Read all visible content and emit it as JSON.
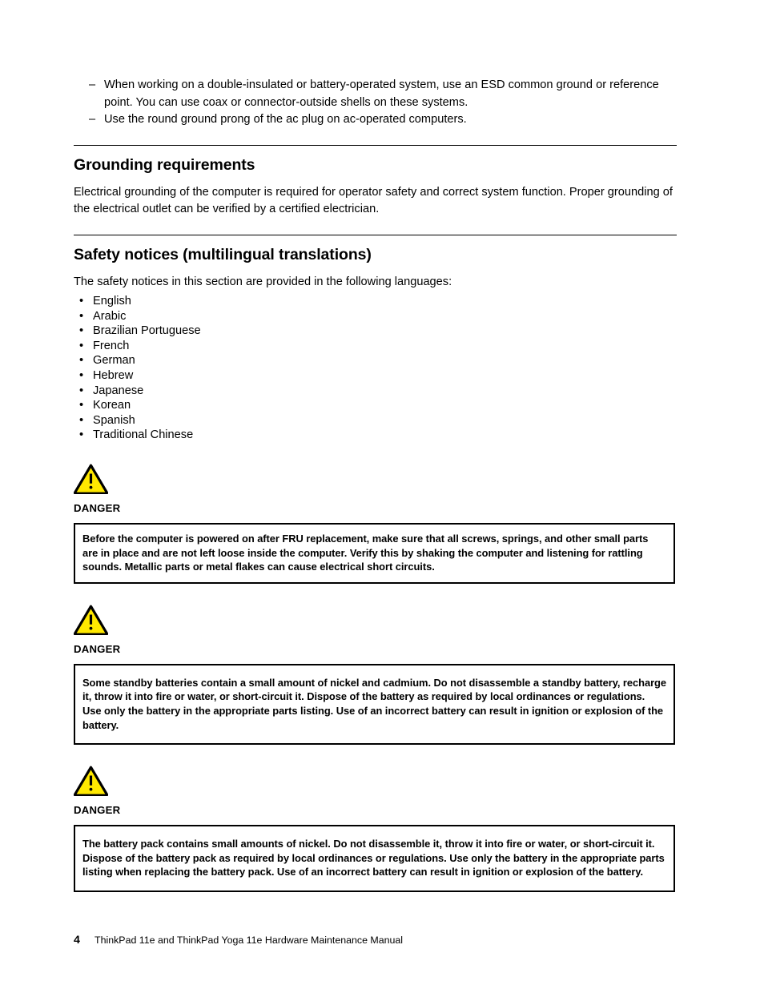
{
  "intro_list": {
    "marker": "–",
    "items": [
      "When working on a double-insulated or battery-operated system, use an ESD common ground or reference point.  You can use coax or connector-outside shells on these systems.",
      "Use the round ground prong of the ac plug on ac-operated computers."
    ]
  },
  "sections": [
    {
      "heading": "Grounding requirements",
      "body": "Electrical grounding of the computer is required for operator safety and correct system function.  Proper grounding of the electrical outlet can be verified by a certified electrician."
    },
    {
      "heading": "Safety notices (multilingual translations)",
      "body": "The safety notices in this section are provided in the following languages:"
    }
  ],
  "language_list": {
    "marker": "•",
    "items": [
      "English",
      "Arabic",
      "Brazilian Portuguese",
      "French",
      "German",
      "Hebrew",
      "Japanese",
      "Korean",
      "Spanish",
      "Traditional Chinese"
    ]
  },
  "notices": [
    {
      "icon": "warning-triangle-icon",
      "label": "DANGER",
      "text": "Before the computer is powered on after FRU replacement, make sure that all screws, springs, and other small parts are in place and are not left loose inside the computer.  Verify this by shaking the computer and listening for rattling sounds.  Metallic parts or metal flakes can cause electrical short circuits."
    },
    {
      "icon": "warning-triangle-icon",
      "label": "DANGER",
      "text": "Some standby batteries contain a small amount of nickel and cadmium. Do not disassemble a standby battery, recharge it, throw it into fire or water, or short-circuit it. Dispose of the battery as required by local ordinances or regulations.  Use only the battery in the appropriate parts listing.  Use of an incorrect battery can result in ignition or explosion of the battery."
    },
    {
      "icon": "warning-triangle-icon",
      "label": "DANGER",
      "text": "The battery pack contains small amounts of nickel.  Do not disassemble it, throw it into fire or water, or short-circuit it.  Dispose of the battery pack as required by local ordinances or regulations.  Use only the battery in the appropriate parts listing when replacing the battery pack. Use of an incorrect battery can result in ignition or explosion of the battery."
    }
  ],
  "footer": {
    "page_number": "4",
    "title": "ThinkPad 11e and ThinkPad Yoga 11e Hardware Maintenance Manual"
  },
  "colors": {
    "warning_fill": "#FFE800",
    "warning_stroke": "#000000",
    "rule": "#000000",
    "text": "#000000"
  }
}
